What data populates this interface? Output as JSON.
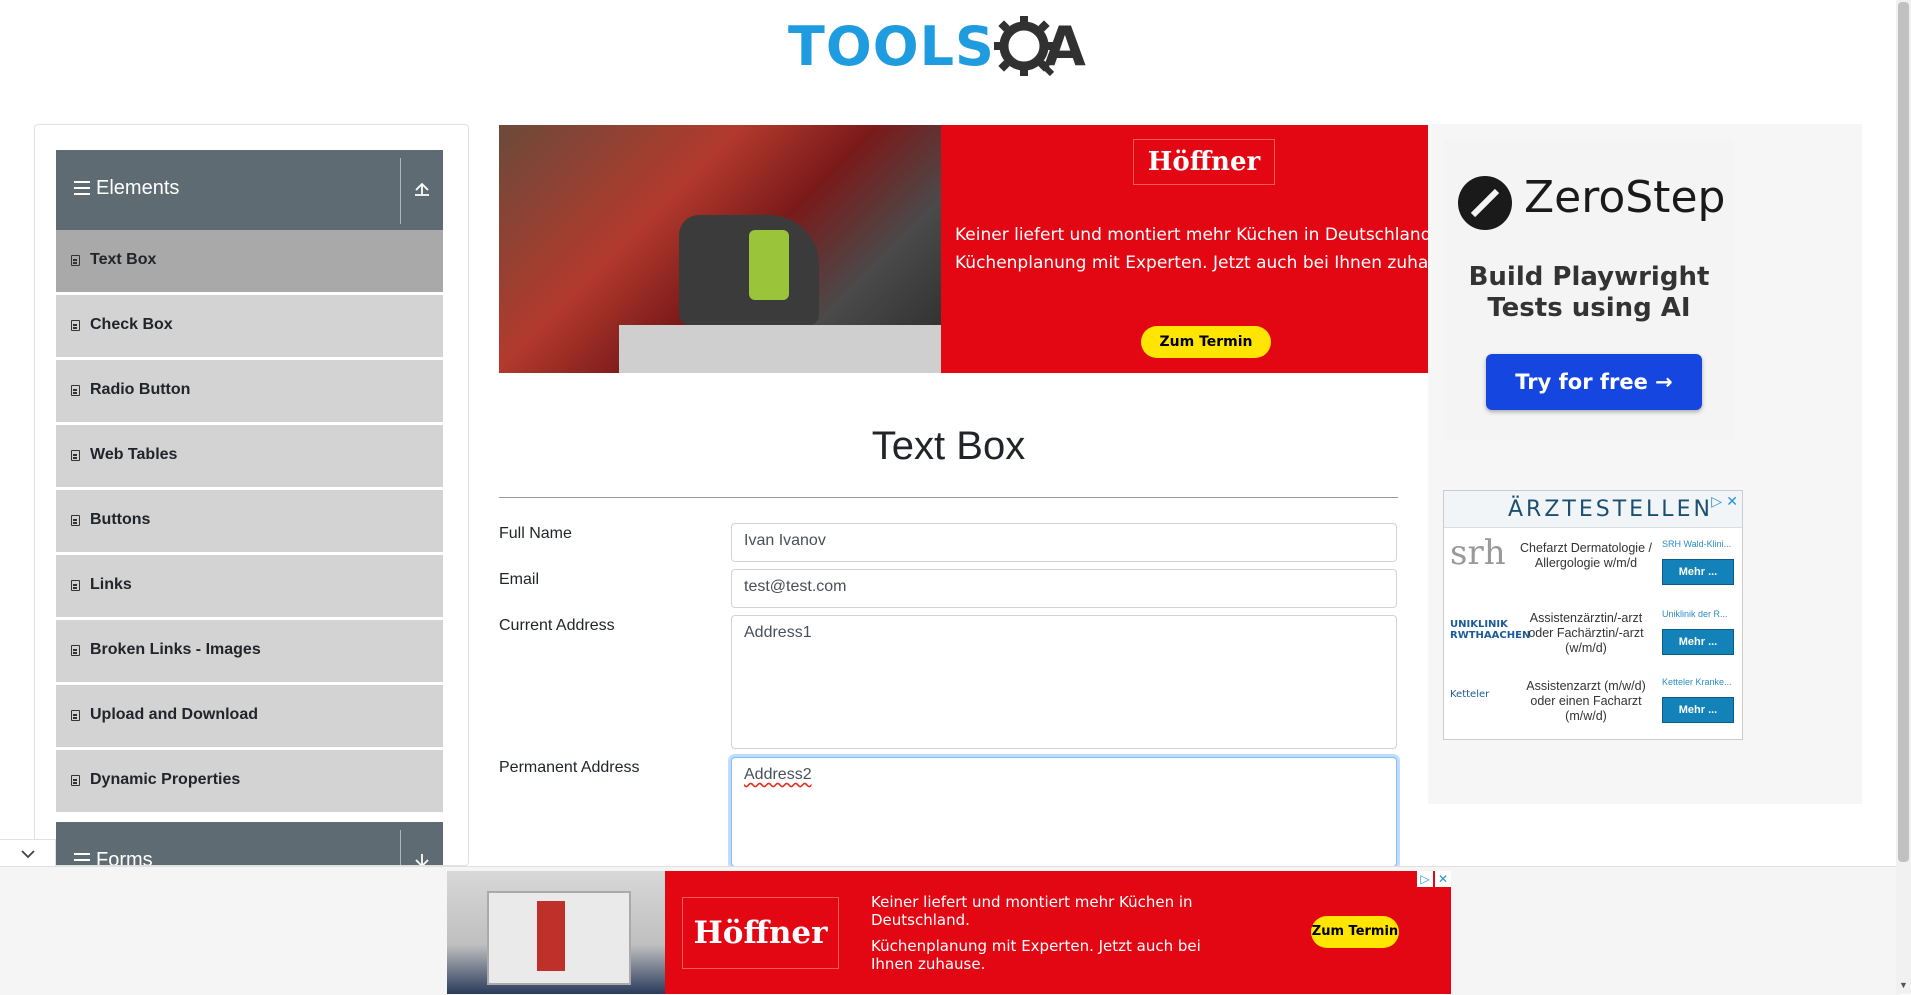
{
  "header": {
    "logo_tools": "TOOLS",
    "logo_a": "A"
  },
  "sidebar": {
    "elements_group": {
      "label": "Elements",
      "icon": "hamburger-icon",
      "toggle_icon": "collapse-up-icon"
    },
    "items": [
      {
        "label": "Text Box",
        "active": true
      },
      {
        "label": "Check Box"
      },
      {
        "label": "Radio Button"
      },
      {
        "label": "Web Tables"
      },
      {
        "label": "Buttons"
      },
      {
        "label": "Links"
      },
      {
        "label": "Broken Links - Images"
      },
      {
        "label": "Upload and Download"
      },
      {
        "label": "Dynamic Properties"
      }
    ],
    "forms_group": {
      "label": "Forms",
      "toggle_icon": "expand-down-icon"
    }
  },
  "ad_top": {
    "brand": "Höffner",
    "line1": "Keiner liefert und montiert mehr Küchen in Deutschland",
    "line2": "Küchenplanung mit Experten. Jetzt auch bei Ihnen zuhau",
    "cta": "Zum Termin"
  },
  "ad_right": {
    "brand": "ZeroStep",
    "tagline_1": "Build Playwright",
    "tagline_2": "Tests using AI",
    "cta": "Try for free →"
  },
  "ad_jobs": {
    "title": "ÄRZTESTELLEN",
    "rows": [
      {
        "logo": "srh",
        "text": "Chefarzt Dermatologie / Allergologie w/m/d",
        "employer": "SRH Wald-Klini...",
        "cta": "Mehr ..."
      },
      {
        "logo": "UNIKLINIK RWTHAACHEN",
        "text": "Assistenzärztin/-arzt oder Fachärztin/-arzt (w/m/d)",
        "employer": "Uniklinik der R...",
        "cta": "Mehr ..."
      },
      {
        "logo": "Ketteler",
        "text": "Assistenzarzt (m/w/d) oder einen Facharzt (m/w/d)",
        "employer": "Ketteler Kranke...",
        "cta": "Mehr ..."
      }
    ]
  },
  "form": {
    "title": "Text Box",
    "full_name_label": "Full Name",
    "full_name_value": "Ivan Ivanov",
    "email_label": "Email",
    "email_value": "test@test.com",
    "current_address_label": "Current Address",
    "current_address_value": "Address1",
    "permanent_address_label": "Permanent Address",
    "permanent_address_value": "Address2"
  },
  "ad_bottom": {
    "brand": "Höffner",
    "line1": "Keiner liefert und montiert mehr Küchen in Deutschland.",
    "line2": "Küchenplanung mit Experten. Jetzt auch bei Ihnen zuhause.",
    "cta": "Zum Termin"
  },
  "colors": {
    "brand_blue": "#1f9be0",
    "menu_header": "#5f6b73",
    "menu_item": "#d3d3d3",
    "menu_active": "#a9a9a9",
    "ad_red": "#e30613",
    "ad_yellow": "#ffe500",
    "zerostep_blue": "#1546e0"
  }
}
